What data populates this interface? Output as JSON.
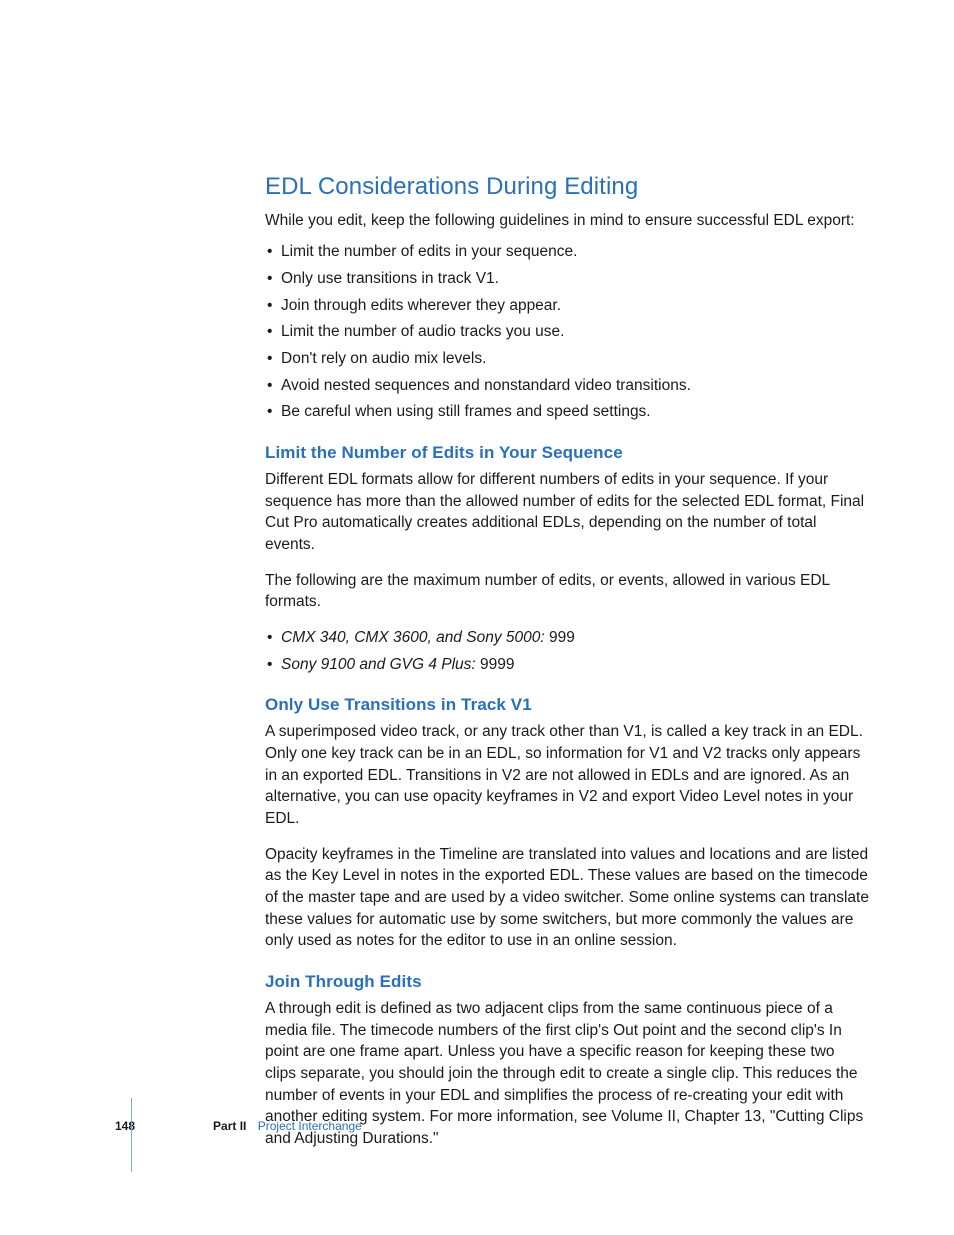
{
  "headings": {
    "main": "EDL Considerations During Editing",
    "sub1": "Limit the Number of Edits in Your Sequence",
    "sub2": "Only Use Transitions in Track V1",
    "sub3": "Join Through Edits"
  },
  "intro": "While you edit, keep the following guidelines in mind to ensure successful EDL export:",
  "bullets": {
    "b0": "Limit the number of edits in your sequence.",
    "b1": "Only use transitions in track V1.",
    "b2": "Join through edits wherever they appear.",
    "b3": "Limit the number of audio tracks you use.",
    "b4": "Don't rely on audio mix levels.",
    "b5": "Avoid nested sequences and nonstandard video transitions.",
    "b6": "Be careful when using still frames and speed settings."
  },
  "section1": {
    "p1": "Different EDL formats allow for different numbers of edits in your sequence. If your sequence has more than the allowed number of edits for the selected EDL format, Final Cut Pro automatically creates additional EDLs, depending on the number of total events.",
    "p2": "The following are the maximum number of edits, or events, allowed in various EDL formats.",
    "format1_label": "CMX 340, CMX 3600, and Sony 5000:",
    "format1_value": "  999",
    "format2_label": "Sony 9100 and GVG 4 Plus:",
    "format2_value": "  9999"
  },
  "section2": {
    "p1": "A superimposed video track, or any track other than V1, is called a key track in an EDL. Only one key track can be in an EDL, so information for V1 and V2 tracks only appears in an exported EDL. Transitions in V2 are not allowed in EDLs and are ignored. As an alternative, you can use opacity keyframes in V2 and export Video Level notes in your EDL.",
    "p2": "Opacity keyframes in the Timeline are translated into values and locations and are listed as the Key Level in notes in the exported EDL. These values are based on the timecode of the master tape and are used by a video switcher. Some online systems can translate these values for automatic use by some switchers, but more commonly the values are only used as notes for the editor to use in an online session."
  },
  "section3": {
    "p1": "A through edit is defined as two adjacent clips from the same continuous piece of a media file. The timecode numbers of the first clip's Out point and the second clip's In point are one frame apart. Unless you have a specific reason for keeping these two clips separate, you should join the through edit to create a single clip. This reduces the number of events in your EDL and simplifies the process of re-creating your edit with another editing system. For more information, see Volume II, Chapter 13, \"Cutting Clips and Adjusting Durations.\""
  },
  "footer": {
    "page": "148",
    "part": "Part II",
    "title": "Project Interchange"
  }
}
